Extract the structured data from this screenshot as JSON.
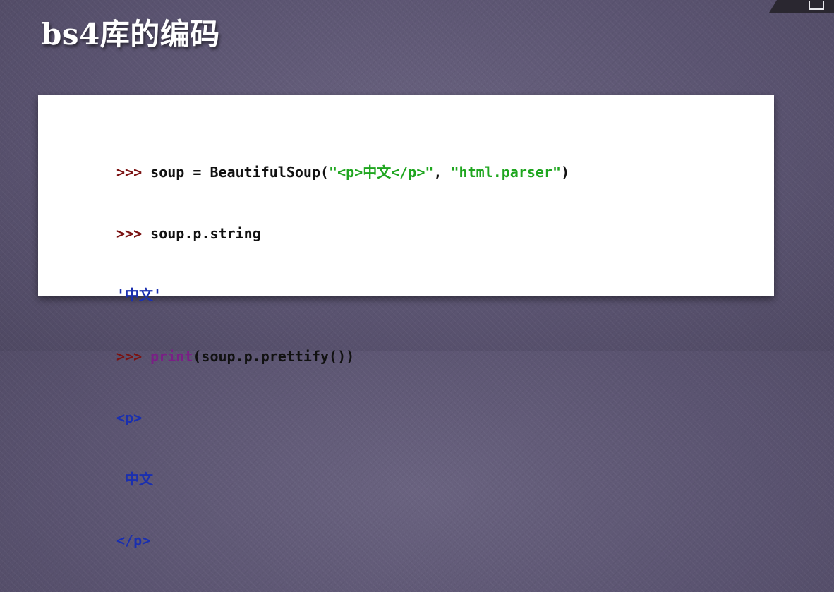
{
  "slide": {
    "title": "bs4库的编码"
  },
  "code": {
    "prompt": ">>>",
    "line1": {
      "lhs": " soup = BeautifulSoup(",
      "arg1": "\"<p>中文</p>\"",
      "sep": ", ",
      "arg2": "\"html.parser\"",
      "close": ")"
    },
    "line2": {
      "text": " soup.p.string"
    },
    "line3": {
      "output": "'中文'"
    },
    "line4": {
      "space": " ",
      "keyword": "print",
      "rest": "(soup.p.prettify())"
    },
    "output_lines": [
      "<p>",
      " 中文",
      "</p>"
    ]
  },
  "colors": {
    "background": "#5d5670",
    "panel": "#ffffff",
    "prompt": "#7b1212",
    "string": "#1fa61f",
    "keyword": "#7a1f86",
    "output": "#1a2fb0"
  }
}
